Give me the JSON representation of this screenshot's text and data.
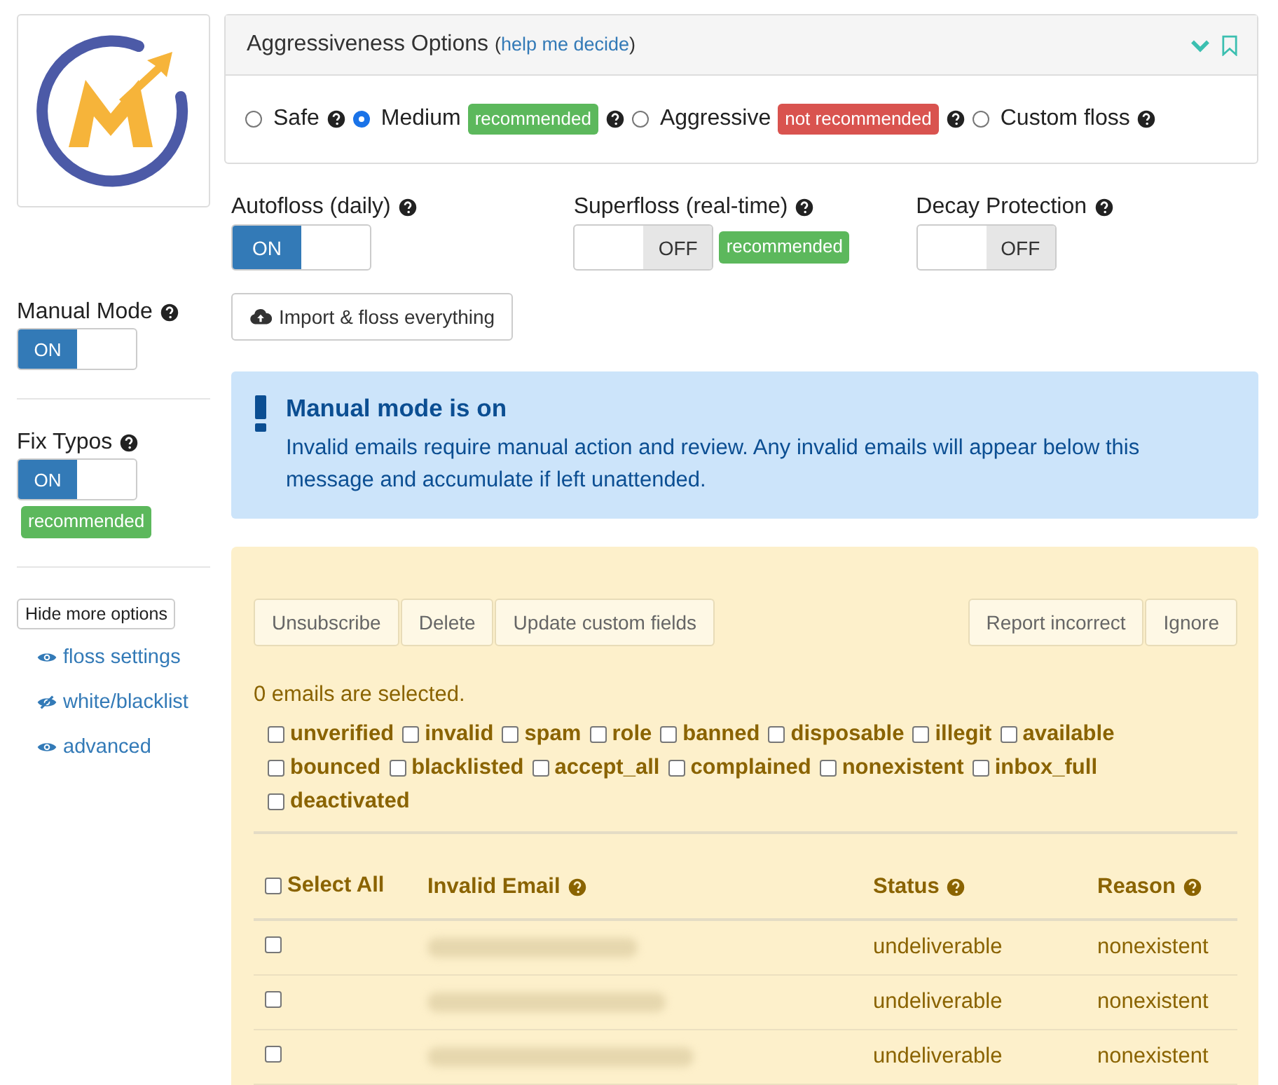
{
  "sidebar": {
    "settings": [
      {
        "label": "Manual Mode",
        "toggle": {
          "on": true,
          "text": "ON"
        }
      },
      {
        "label": "Fix Typos",
        "toggle": {
          "on": true,
          "text": "ON"
        },
        "badge": {
          "text": "recommended",
          "color": "#5cb85c"
        }
      }
    ],
    "options_button": "Hide more options",
    "links": [
      {
        "label": "floss settings",
        "visible": true
      },
      {
        "label": "white/blacklist",
        "visible": false
      },
      {
        "label": "advanced",
        "visible": true
      }
    ]
  },
  "aggressiveness": {
    "title": "Aggressiveness Options",
    "link_open": "(",
    "link": "help me decide",
    "link_close": ")",
    "expanded": true,
    "options": [
      {
        "label": "Safe",
        "selected": false
      },
      {
        "label": "Medium",
        "selected": true,
        "badge": {
          "text": "recommended",
          "color": "#5cb85c"
        }
      },
      {
        "label": "Aggressive",
        "selected": false,
        "badge": {
          "text": "not recommended",
          "color": "#d9534f"
        }
      },
      {
        "label": "Custom floss",
        "selected": false
      }
    ]
  },
  "toggles": [
    {
      "label": "Autofloss (daily)",
      "toggle": {
        "on": true,
        "text": "ON"
      }
    },
    {
      "label": "Superfloss (real-time)",
      "toggle": {
        "on": false,
        "text": "OFF"
      },
      "badge": {
        "text": "recommended",
        "color": "#5cb85c"
      }
    },
    {
      "label": "Decay Protection",
      "toggle": {
        "on": false,
        "text": "OFF"
      }
    }
  ],
  "import_button": "Import & floss everything",
  "alert": {
    "title": "Manual mode is on",
    "text": "Invalid emails require manual action and review. Any invalid emails will appear below this message and accumulate if left unattended."
  },
  "review": {
    "actions_left": [
      "Unsubscribe",
      "Delete",
      "Update custom fields"
    ],
    "actions_right": [
      "Report incorrect",
      "Ignore"
    ],
    "selection": "0 emails are selected.",
    "filters": [
      {
        "label": "unverified",
        "checked": false
      },
      {
        "label": "invalid",
        "checked": false
      },
      {
        "label": "spam",
        "checked": false
      },
      {
        "label": "role",
        "checked": false
      },
      {
        "label": "banned",
        "checked": false
      },
      {
        "label": "disposable",
        "checked": false
      },
      {
        "label": "illegit",
        "checked": false
      },
      {
        "label": "available",
        "checked": false
      },
      {
        "label": "bounced",
        "checked": false
      },
      {
        "label": "blacklisted",
        "checked": false
      },
      {
        "label": "accept_all",
        "checked": false
      },
      {
        "label": "complained",
        "checked": false
      },
      {
        "label": "nonexistent",
        "checked": false
      },
      {
        "label": "inbox_full",
        "checked": false
      },
      {
        "label": "deactivated",
        "checked": false
      }
    ],
    "table": {
      "select_all": {
        "label": "Select All",
        "checked": false
      },
      "columns": [
        {
          "label": "Invalid Email",
          "help": true
        },
        {
          "label": "Status",
          "help": true
        },
        {
          "label": "Reason",
          "help": true
        }
      ],
      "rows": [
        {
          "selected": false,
          "email_redacted": true,
          "status": "undeliverable",
          "reason": "nonexistent"
        },
        {
          "selected": false,
          "email_redacted": true,
          "status": "undeliverable",
          "reason": "nonexistent"
        },
        {
          "selected": false,
          "email_redacted": true,
          "status": "undeliverable",
          "reason": "nonexistent"
        }
      ]
    }
  }
}
